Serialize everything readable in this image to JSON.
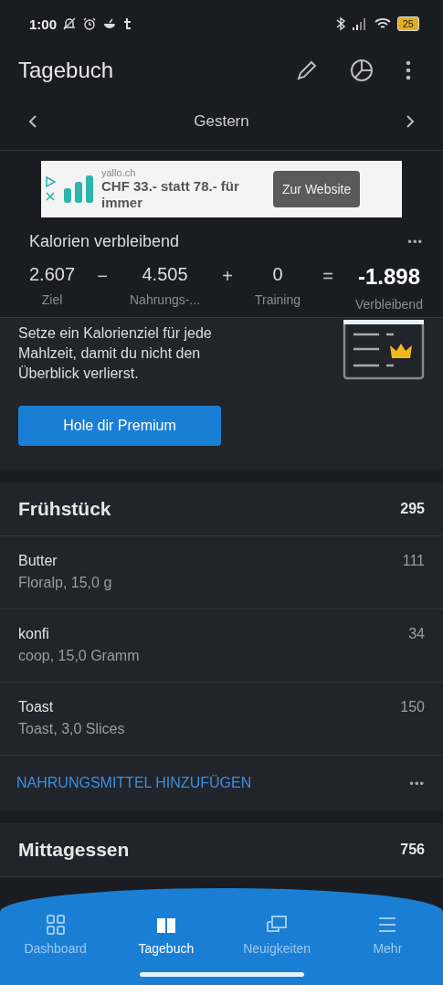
{
  "status_bar": {
    "time": "1:00",
    "battery": "25"
  },
  "app_bar": {
    "title": "Tagebuch"
  },
  "date_nav": {
    "label": "Gestern"
  },
  "ad": {
    "domain": "yallo.ch",
    "headline": "CHF 33.- statt 78.- für immer",
    "button": "Zur Website"
  },
  "calories": {
    "title": "Kalorien verbleibend",
    "more": "•••",
    "terms": [
      {
        "value": "2.607",
        "label": "Ziel",
        "kind": "term"
      },
      {
        "value": "−",
        "kind": "op"
      },
      {
        "value": "4.505",
        "label": "Nahrungs-...",
        "kind": "term"
      },
      {
        "value": "+",
        "kind": "op"
      },
      {
        "value": "0",
        "label": "Training",
        "kind": "term"
      },
      {
        "value": "=",
        "kind": "op"
      },
      {
        "value": "-1.898",
        "label": "Verbleibend",
        "kind": "result"
      }
    ]
  },
  "premium": {
    "text": "Setze ein Kalorienziel für jede Mahlzeit, damit du nicht den Überblick verlierst.",
    "button": "Hole dir Premium"
  },
  "meals": [
    {
      "name": "Frühstück",
      "total": "295",
      "items": [
        {
          "name": "Butter",
          "detail": "Floralp, 15,0 g",
          "kcal": "111"
        },
        {
          "name": "konfi",
          "detail": "coop, 15,0 Gramm",
          "kcal": "34"
        },
        {
          "name": "Toast",
          "detail": "Toast, 3,0 Slices",
          "kcal": "150"
        }
      ],
      "add": "NAHRUNGSMITTEL HINZUFÜGEN",
      "more": "•••"
    },
    {
      "name": "Mittagessen",
      "total": "756"
    }
  ],
  "bottom_nav": [
    {
      "label": "Dashboard",
      "kind": "dashboard",
      "selected": false
    },
    {
      "label": "Tagebuch",
      "kind": "diary",
      "selected": true
    },
    {
      "label": "Neuigkeiten",
      "kind": "news",
      "selected": false
    },
    {
      "label": "Mehr",
      "kind": "more",
      "selected": false
    }
  ]
}
